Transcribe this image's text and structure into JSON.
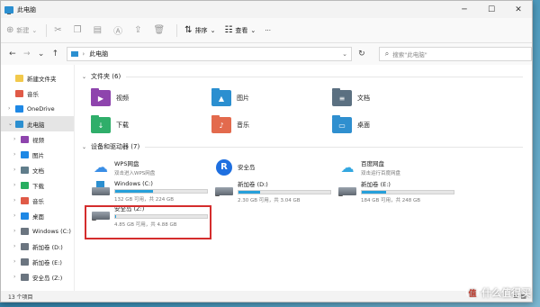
{
  "window": {
    "title": "此电脑"
  },
  "toolbar": {
    "new_label": "新建",
    "sort_label": "排序",
    "view_label": "查看",
    "more_label": "···"
  },
  "address": {
    "location": "此电脑",
    "search_placeholder": "搜索\"此电脑\""
  },
  "sidebar": {
    "items": [
      {
        "label": "新建文件夹",
        "icon": "folder-icon",
        "color": "#f2c94c"
      },
      {
        "label": "音乐",
        "icon": "music-icon",
        "color": "#e05a47"
      },
      {
        "label": "OneDrive",
        "icon": "cloud-icon",
        "color": "#1e88e5"
      },
      {
        "label": "此电脑",
        "icon": "pc-icon",
        "color": "#2b8fd0"
      },
      {
        "label": "视频",
        "icon": "video-icon",
        "color": "#8e44ad"
      },
      {
        "label": "图片",
        "icon": "picture-icon",
        "color": "#1e88e5"
      },
      {
        "label": "文档",
        "icon": "document-icon",
        "color": "#607d8b"
      },
      {
        "label": "下载",
        "icon": "download-icon",
        "color": "#27ae60"
      },
      {
        "label": "音乐",
        "icon": "music-icon",
        "color": "#e05a47"
      },
      {
        "label": "桌面",
        "icon": "desktop-icon",
        "color": "#1e88e5"
      },
      {
        "label": "Windows  (C:)",
        "icon": "drive-icon",
        "color": "#6b7580"
      },
      {
        "label": "新加卷 (D:)",
        "icon": "drive-icon",
        "color": "#6b7580"
      },
      {
        "label": "新加卷 (E:)",
        "icon": "drive-icon",
        "color": "#6b7580"
      },
      {
        "label": "安全岛 (Z:)",
        "icon": "drive-icon",
        "color": "#6b7580"
      }
    ]
  },
  "groups": {
    "folders_header": "文件夹 (6)",
    "devices_header": "设备和驱动器 (7)"
  },
  "folders": [
    {
      "label": "视频",
      "icon": "video-icon",
      "color": "#8e44ad",
      "glyph": "▶"
    },
    {
      "label": "图片",
      "icon": "picture-icon",
      "color": "#2b8fd0",
      "glyph": "▲"
    },
    {
      "label": "文档",
      "icon": "document-icon",
      "color": "#5b7081",
      "glyph": "≡"
    },
    {
      "label": "下载",
      "icon": "download-icon",
      "color": "#2fae6a",
      "glyph": "↓"
    },
    {
      "label": "音乐",
      "icon": "music-icon",
      "color": "#e36a4d",
      "glyph": "♪"
    },
    {
      "label": "桌面",
      "icon": "desktop-icon",
      "color": "#2f8fcf",
      "glyph": "▭"
    }
  ],
  "devices": [
    {
      "name": "WPS网盘",
      "sub": "双击进入WPS网盘",
      "icon": "wps-cloud-icon",
      "type": "app"
    },
    {
      "name": "安全岛",
      "sub": "",
      "icon": "anquandao-icon",
      "type": "app"
    },
    {
      "name": "百度网盘",
      "sub": "双击运行百度网盘",
      "icon": "baidu-cloud-icon",
      "type": "app"
    },
    {
      "name": "Windows (C:)",
      "sub": "132 GB 可用，共 224 GB",
      "icon": "windows-drive-icon",
      "type": "drive",
      "fill": 0.41
    },
    {
      "name": "新加卷 (D:)",
      "sub": "2.30 GB 可用，共 3.04 GB",
      "icon": "drive-icon",
      "type": "drive",
      "fill": 0.24
    },
    {
      "name": "新加卷 (E:)",
      "sub": "184 GB 可用，共 248 GB",
      "icon": "drive-icon",
      "type": "drive",
      "fill": 0.26
    },
    {
      "name": "安全岛 (Z:)",
      "sub": "4.85 GB 可用，共 4.88 GB",
      "icon": "drive-icon",
      "type": "drive",
      "fill": 0.01
    }
  ],
  "status": {
    "count": "13 个项目"
  },
  "watermark": {
    "text": "什么值得买"
  }
}
